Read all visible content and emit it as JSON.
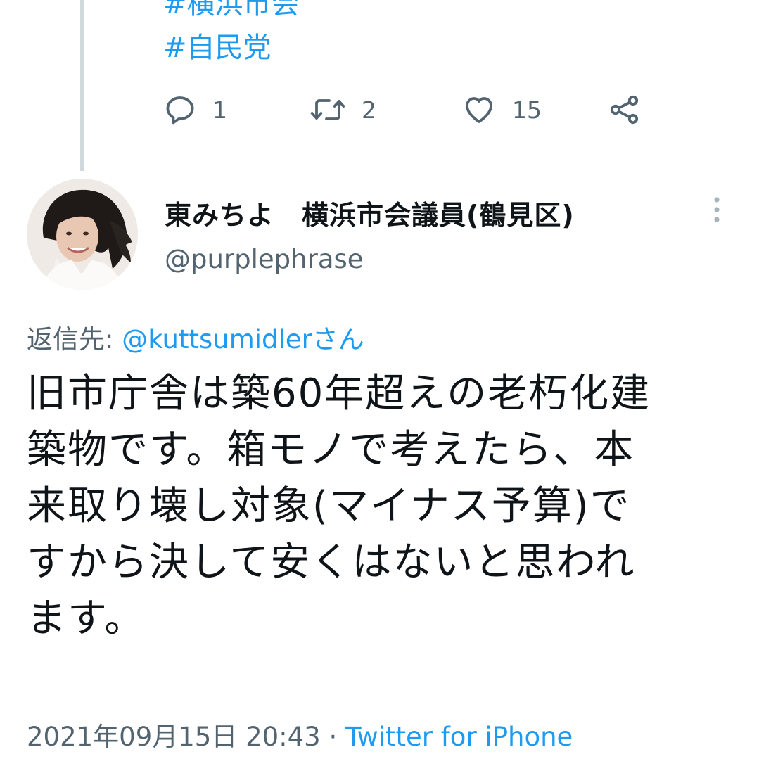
{
  "previous_tweet": {
    "hashtags": [
      "#横浜市会",
      "#自民党"
    ],
    "actions": {
      "reply_count": "1",
      "retweet_count": "2",
      "like_count": "15"
    }
  },
  "tweet": {
    "display_name": "東みちよ　横浜市会議員(鶴見区)",
    "handle": "@purplephrase",
    "reply_to_label": "返信先: ",
    "reply_to_mention": "@kuttsumidlerさん",
    "text_lines": [
      "旧市庁舎は築60年超えの老朽化建",
      "築物です。箱モノで考えたら、本",
      "来取り壊し対象(マイナス予算)で",
      "すから決して安くはないと思われ",
      "ます。"
    ],
    "timestamp": "2021年09月15日 20:43",
    "separator": " · ",
    "source": "Twitter for iPhone"
  },
  "colors": {
    "accent": "#1d9bf0",
    "secondary_text": "#536471",
    "primary_text": "#0f1419",
    "thread_line": "#cfd9de"
  },
  "icons": {
    "reply": "speech-bubble-icon",
    "retweet": "retweet-arrows-icon",
    "like": "heart-icon",
    "share": "share-nodes-icon",
    "more": "vertical-dots-icon"
  }
}
